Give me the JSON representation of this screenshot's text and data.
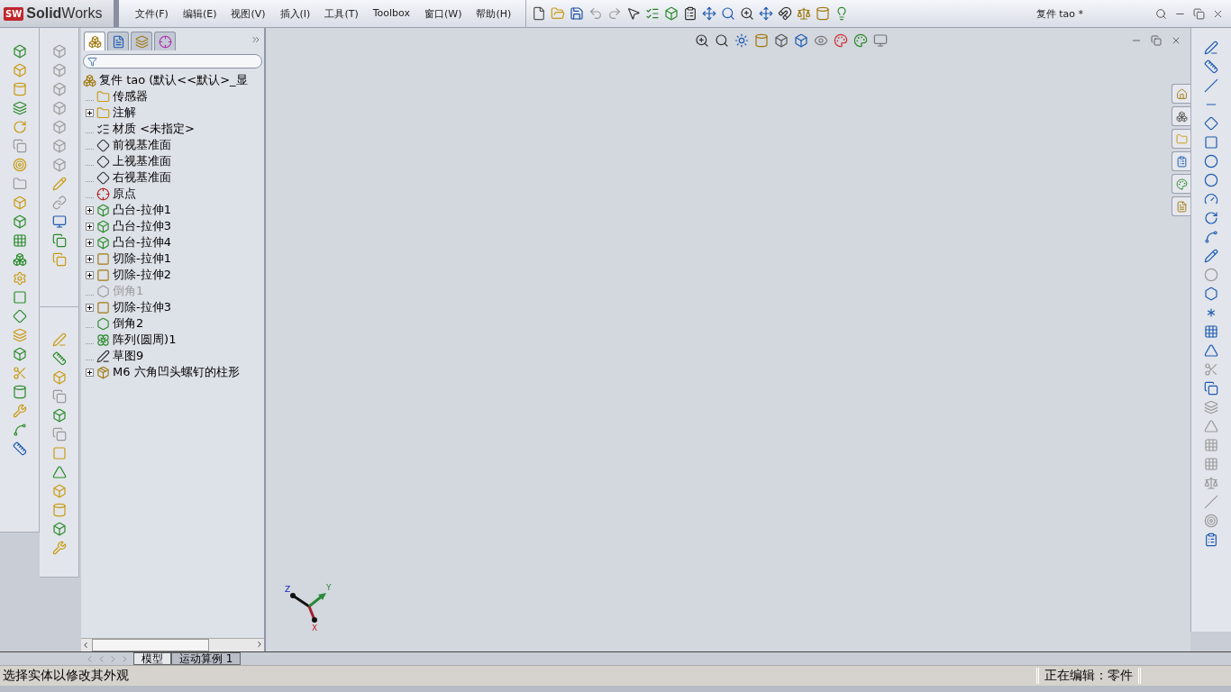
{
  "logo": {
    "badge": "SW",
    "wordmark": "**Solid**Works"
  },
  "menus": [
    "文件(F)",
    "编辑(E)",
    "视图(V)",
    "插入(I)",
    "工具(T)",
    "Toolbox",
    "窗口(W)",
    "帮助(H)"
  ],
  "document_title": "复件 tao *",
  "panel_tabs": [
    {
      "kind": "feature",
      "selected": true
    },
    {
      "kind": "property",
      "selected": false
    },
    {
      "kind": "config",
      "selected": false
    },
    {
      "kind": "dimxpert",
      "selected": false
    }
  ],
  "feature_tree": {
    "label": "复件 tao  (默认<<默认>_显",
    "kind": "part",
    "children": [
      {
        "label": "传感器",
        "kind": "sensor",
        "expandable": false,
        "suppressed": false
      },
      {
        "label": "注解",
        "kind": "annotation",
        "expandable": true,
        "suppressed": false
      },
      {
        "label": "材质 <未指定>",
        "kind": "material",
        "expandable": false,
        "suppressed": false
      },
      {
        "label": "前视基准面",
        "kind": "plane",
        "expandable": false,
        "suppressed": false
      },
      {
        "label": "上视基准面",
        "kind": "plane",
        "expandable": false,
        "suppressed": false
      },
      {
        "label": "右视基准面",
        "kind": "plane",
        "expandable": false,
        "suppressed": false
      },
      {
        "label": "原点",
        "kind": "origin",
        "expandable": false,
        "suppressed": false
      },
      {
        "label": "凸台-拉伸1",
        "kind": "boss",
        "expandable": true,
        "suppressed": false
      },
      {
        "label": "凸台-拉伸3",
        "kind": "boss",
        "expandable": true,
        "suppressed": false
      },
      {
        "label": "凸台-拉伸4",
        "kind": "boss",
        "expandable": true,
        "suppressed": false
      },
      {
        "label": "切除-拉伸1",
        "kind": "cut",
        "expandable": true,
        "suppressed": false
      },
      {
        "label": "切除-拉伸2",
        "kind": "cut",
        "expandable": true,
        "suppressed": false
      },
      {
        "label": "倒角1",
        "kind": "chamfer",
        "expandable": false,
        "suppressed": true
      },
      {
        "label": "切除-拉伸3",
        "kind": "cut",
        "expandable": true,
        "suppressed": false
      },
      {
        "label": "倒角2",
        "kind": "chamfer",
        "expandable": false,
        "suppressed": false
      },
      {
        "label": "阵列(圆周)1",
        "kind": "pattern",
        "expandable": false,
        "suppressed": false
      },
      {
        "label": "草图9",
        "kind": "sketch",
        "expandable": false,
        "suppressed": false
      },
      {
        "label": "M6 六角凹头螺钉的柱形",
        "kind": "hole",
        "expandable": true,
        "suppressed": false
      }
    ]
  },
  "bottom_tabs": [
    {
      "label": "模型",
      "selected": true
    },
    {
      "label": "运动算例 1",
      "selected": false
    }
  ],
  "triad": {
    "x_label": "X",
    "y_label": "Y",
    "z_label": "Z"
  },
  "status_bar": {
    "message": "选择实体以修改其外观",
    "mode": "正在编辑：零件"
  }
}
